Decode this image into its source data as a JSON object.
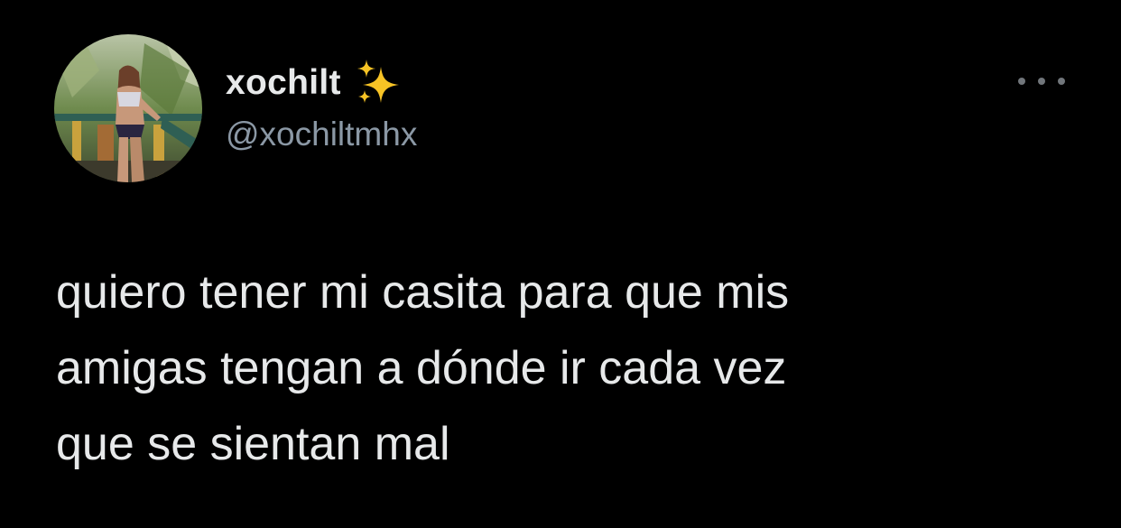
{
  "user": {
    "display_name": "xochilt",
    "name_emoji": "sparkles-icon",
    "handle": "@xochiltmhx",
    "avatar": "profile-photo"
  },
  "menu": {
    "icon": "more-horizontal-icon"
  },
  "tweet": {
    "lines": [
      "quiero tener mi casita para que mis",
      "amigas tengan a dónde ir cada vez",
      "que se sientan mal"
    ]
  },
  "colors": {
    "background": "#000000",
    "primary_text": "#e7e9ea",
    "secondary_text": "#8b98a5",
    "sparkle": "#f7c325"
  }
}
